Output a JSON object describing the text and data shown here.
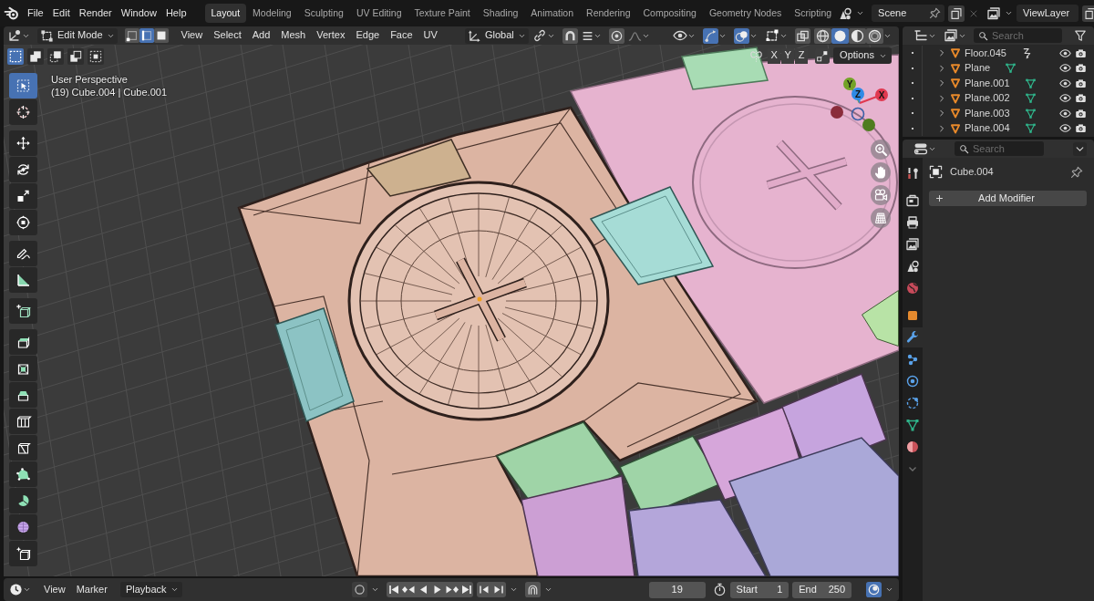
{
  "top_bar": {
    "menus": [
      "File",
      "Edit",
      "Render",
      "Window",
      "Help"
    ],
    "workspaces": [
      {
        "label": "Layout",
        "selected": true
      },
      {
        "label": "Modeling",
        "selected": false
      },
      {
        "label": "Sculpting",
        "selected": false
      },
      {
        "label": "UV Editing",
        "selected": false
      },
      {
        "label": "Texture Paint",
        "selected": false
      },
      {
        "label": "Shading",
        "selected": false
      },
      {
        "label": "Animation",
        "selected": false
      },
      {
        "label": "Rendering",
        "selected": false
      },
      {
        "label": "Compositing",
        "selected": false
      },
      {
        "label": "Geometry Nodes",
        "selected": false
      },
      {
        "label": "Scripting",
        "selected": false
      }
    ],
    "scene": "Scene",
    "view_layer": "ViewLayer"
  },
  "viewport_header": {
    "mode": "Edit Mode",
    "select_modes": [
      {
        "kind": "vertex",
        "selected": false
      },
      {
        "kind": "edge",
        "selected": true
      },
      {
        "kind": "face",
        "selected": false
      }
    ],
    "menus": [
      "View",
      "Select",
      "Add",
      "Mesh",
      "Vertex",
      "Edge",
      "Face",
      "UV"
    ],
    "orientation": "Global",
    "gizmos_on": true,
    "overlays_on": true,
    "xray_on": false,
    "shading": [
      {
        "kind": "wireframe",
        "selected": false
      },
      {
        "kind": "solid",
        "selected": true
      },
      {
        "kind": "material",
        "selected": false
      },
      {
        "kind": "rendered",
        "selected": false
      }
    ]
  },
  "tool_settings": {
    "select_tools": [
      {
        "kind": "set",
        "selected": true
      },
      {
        "kind": "extend",
        "selected": false
      },
      {
        "kind": "subtract",
        "selected": false
      },
      {
        "kind": "invert",
        "selected": false
      },
      {
        "kind": "intersect",
        "selected": false
      }
    ],
    "mirror_axes": [
      "X",
      "Y",
      "Z"
    ],
    "options": "Options"
  },
  "viewport": {
    "info": [
      "User Perspective",
      "(19) Cube.004 | Cube.001"
    ],
    "tool_groups": [
      [
        {
          "kind": "select",
          "selected": true
        },
        {
          "kind": "cursor",
          "selected": false
        }
      ],
      [
        {
          "kind": "move",
          "selected": false
        },
        {
          "kind": "rotate",
          "selected": false
        },
        {
          "kind": "scale",
          "selected": false
        },
        {
          "kind": "transform",
          "selected": false
        }
      ],
      [
        {
          "kind": "annotate",
          "selected": false
        },
        {
          "kind": "measure",
          "selected": false
        }
      ],
      [
        {
          "kind": "add_cube",
          "selected": false
        }
      ],
      [
        {
          "kind": "extrude",
          "selected": false
        },
        {
          "kind": "inset",
          "selected": false
        },
        {
          "kind": "bevel",
          "selected": false
        },
        {
          "kind": "loop_cut",
          "selected": false
        },
        {
          "kind": "knife",
          "selected": false
        },
        {
          "kind": "poly_build",
          "selected": false
        },
        {
          "kind": "spin",
          "selected": false
        },
        {
          "kind": "smooth",
          "selected": false
        },
        {
          "kind": "shrink",
          "selected": false
        }
      ]
    ],
    "axes": [
      {
        "kind": "ring",
        "color": "#3b5fa6"
      },
      {
        "kind": "negative",
        "color": "#8a2c3b"
      },
      {
        "kind": "negative",
        "color": "#4f7c1e"
      },
      {
        "kind": "positive",
        "label": "Y",
        "color": "#73a226"
      },
      {
        "kind": "positive",
        "label": "Z",
        "color": "#2f8ae6"
      },
      {
        "kind": "positive",
        "label": "X",
        "color": "#e0384f"
      }
    ]
  },
  "outliner": {
    "search": {
      "placeholder": "Search"
    },
    "items": [
      {
        "name": "Floor.045",
        "kind": "constraint"
      },
      {
        "name": "Plane",
        "kind": "mesh"
      },
      {
        "name": "Plane.001",
        "kind": "mesh"
      },
      {
        "name": "Plane.002",
        "kind": "mesh"
      },
      {
        "name": "Plane.003",
        "kind": "mesh"
      },
      {
        "name": "Plane.004",
        "kind": "mesh"
      }
    ]
  },
  "properties": {
    "search": {
      "placeholder": "Search"
    },
    "tab_groups": [
      [
        {
          "kind": "tool",
          "selected": false
        }
      ],
      [
        {
          "kind": "render",
          "selected": false
        },
        {
          "kind": "output",
          "selected": false
        },
        {
          "kind": "view_layer",
          "selected": false
        },
        {
          "kind": "scene",
          "selected": false
        },
        {
          "kind": "world",
          "selected": false
        }
      ],
      [
        {
          "kind": "object",
          "selected": false
        },
        {
          "kind": "modifiers",
          "selected": true
        },
        {
          "kind": "particles",
          "selected": false
        },
        {
          "kind": "physics",
          "selected": false
        },
        {
          "kind": "constraints",
          "selected": false
        },
        {
          "kind": "data",
          "selected": false
        },
        {
          "kind": "material",
          "selected": false
        },
        {
          "kind": "collapse",
          "selected": false
        }
      ]
    ],
    "object": "Cube.004",
    "add_button": "Add Modifier"
  },
  "timeline": {
    "menus": [
      "View",
      "Marker"
    ],
    "playback": "Playback",
    "auto_key_on": false,
    "frame": "19",
    "start": {
      "label": "Start",
      "value": "1"
    },
    "end": {
      "label": "End",
      "value": "250"
    },
    "sync_on": true
  }
}
